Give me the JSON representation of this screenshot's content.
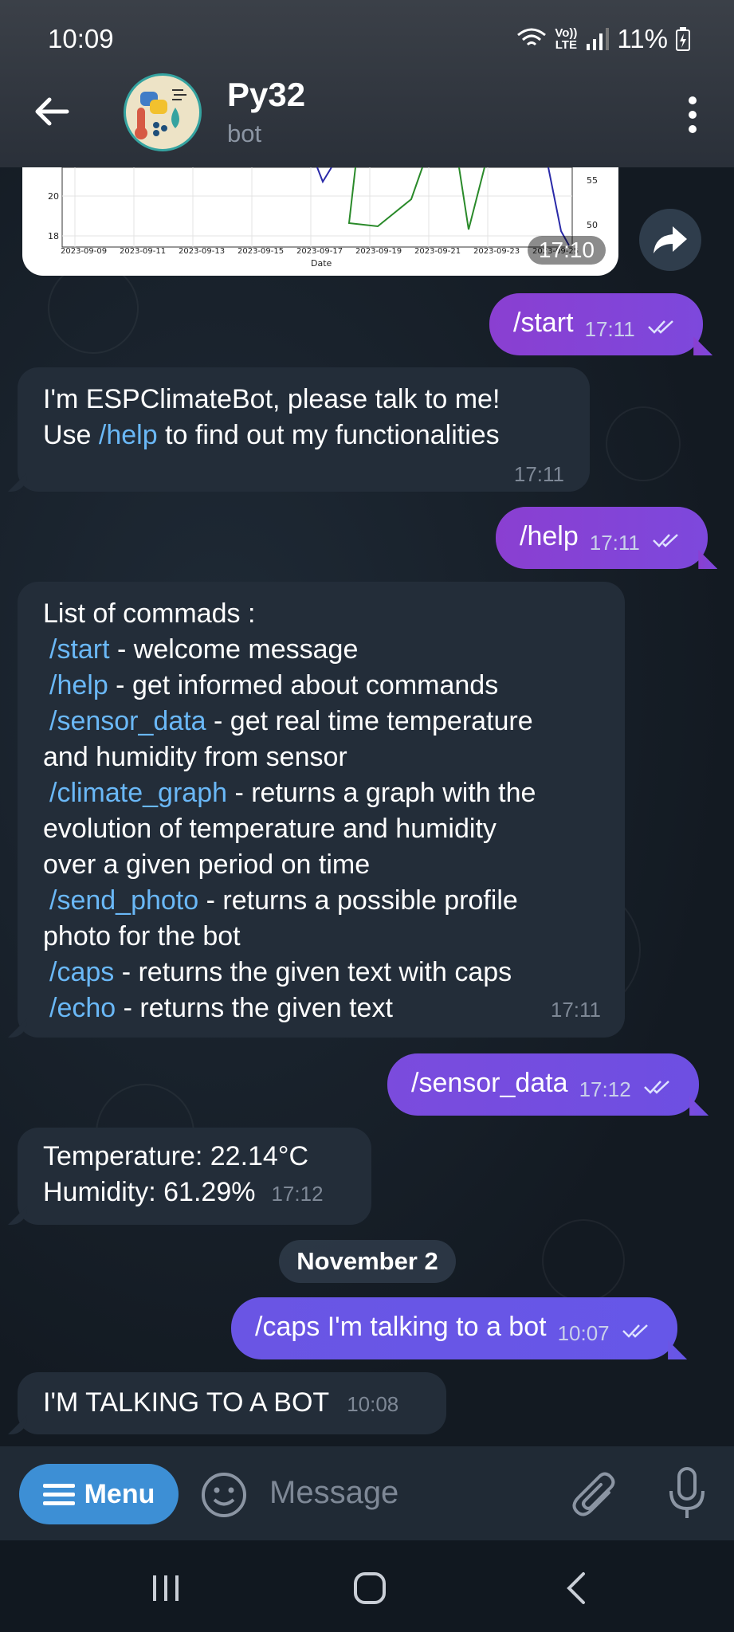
{
  "status": {
    "time": "10:09",
    "battery": "11%",
    "net_top": "Vo))",
    "net_bottom": "LTE"
  },
  "header": {
    "title": "Py32",
    "subtitle": "bot"
  },
  "chart_preview": {
    "y_ticks_left": [
      "20",
      "18"
    ],
    "y_ticks_right": [
      "55",
      "50"
    ],
    "x_ticks": [
      "2023-09-09",
      "2023-09-11",
      "2023-09-13",
      "2023-09-15",
      "2023-09-17",
      "2023-09-19",
      "2023-09-21",
      "2023-09-23",
      "2023-09-25"
    ],
    "xlabel": "Date",
    "time": "17:10"
  },
  "messages": [
    {
      "dir": "out",
      "text": "/start",
      "time": "17:11"
    },
    {
      "dir": "in",
      "lines": [
        "I'm ESPClimateBot, please talk to me!"
      ],
      "pre": "Use ",
      "cmd": "/help",
      "post": " to find out my functionalities",
      "time": "17:11"
    },
    {
      "dir": "out",
      "text": "/help",
      "time": "17:11"
    },
    {
      "dir": "in",
      "title": "List of commads :",
      "commands": [
        {
          "cmd": "/start",
          "desc": " - welcome message",
          "cont": ""
        },
        {
          "cmd": "/help",
          "desc": " - get informed about commands",
          "cont": ""
        },
        {
          "cmd": "/sensor_data",
          "desc": " - get real time temperature",
          "cont": "and humidity from sensor"
        },
        {
          "cmd": "/climate_graph",
          "desc": " - returns a graph with the",
          "cont": "evolution of temperature and humidity"
        },
        {
          "cmd": "",
          "desc": "",
          "cont": "over a given period on time"
        },
        {
          "cmd": "/send_photo",
          "desc": " - returns a possible profile",
          "cont": "photo for the bot"
        },
        {
          "cmd": "/caps",
          "desc": " - returns the given text with caps",
          "cont": ""
        },
        {
          "cmd": "/echo",
          "desc": " - returns the given text",
          "cont": ""
        }
      ],
      "time": "17:11"
    },
    {
      "dir": "out",
      "text": "/sensor_data",
      "time": "17:12"
    },
    {
      "dir": "in",
      "lines": [
        "Temperature: 22.14°C",
        "Humidity: 61.29%"
      ],
      "time": "17:12"
    },
    {
      "dir": "date",
      "text": "November 2"
    },
    {
      "dir": "out",
      "text": "/caps I'm talking to a bot",
      "time": "10:07"
    },
    {
      "dir": "in",
      "lines": [
        "I'M TALKING TO A BOT"
      ],
      "time": "10:08"
    }
  ],
  "input": {
    "menu_label": "Menu",
    "placeholder": "Message"
  },
  "colors": {
    "accent_out_a": "#8a3fd1",
    "accent_out_b": "#6457e6",
    "link": "#6ab8f7",
    "menu": "#3d8fd5"
  }
}
